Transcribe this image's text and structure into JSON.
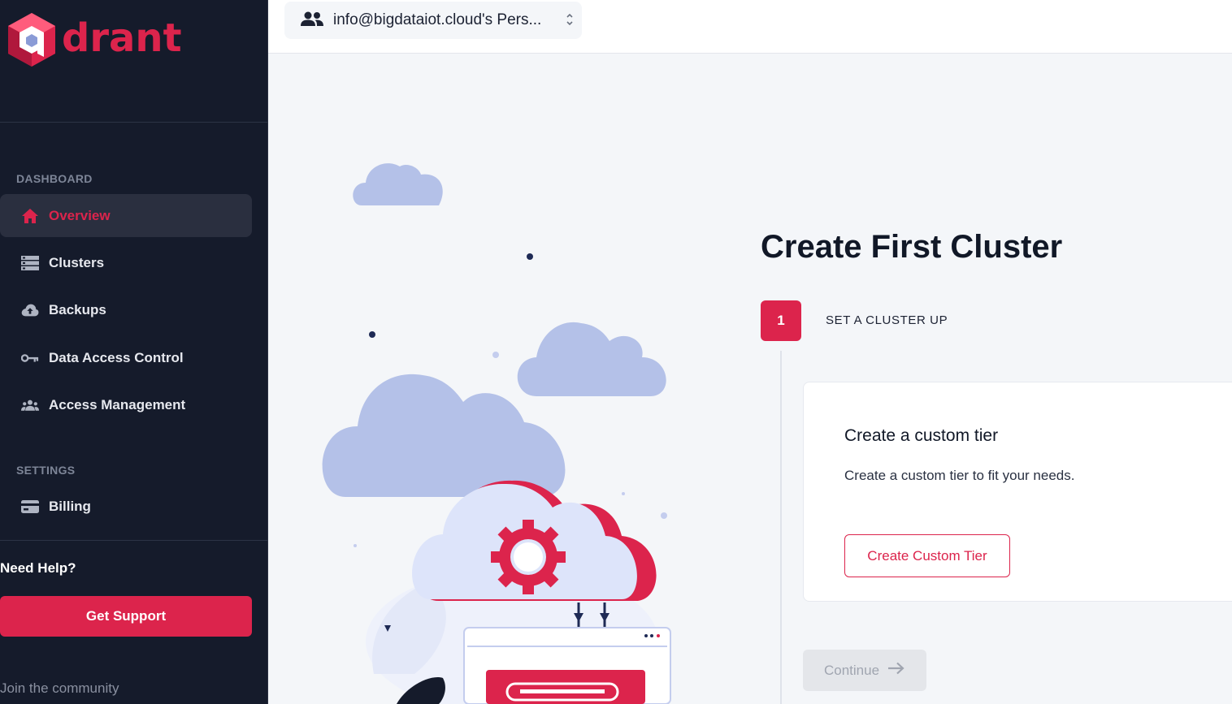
{
  "brand": {
    "logo_text": "drant",
    "accent": "#dc244c"
  },
  "topbar": {
    "account_label": "info@bigdataiot.cloud's Pers..."
  },
  "sidebar": {
    "section_dashboard": "DASHBOARD",
    "items": [
      {
        "label": "Overview",
        "icon": "home-icon",
        "active": true
      },
      {
        "label": "Clusters",
        "icon": "server-icon"
      },
      {
        "label": "Backups",
        "icon": "cloud-upload-icon"
      },
      {
        "label": "Data Access Control",
        "icon": "key-icon"
      },
      {
        "label": "Access Management",
        "icon": "people-icon"
      }
    ],
    "section_settings": "SETTINGS",
    "settings_items": [
      {
        "label": "Billing",
        "icon": "credit-card-icon"
      }
    ],
    "help_title": "Need Help?",
    "support_button": "Get Support",
    "community_link": "Join the community"
  },
  "main": {
    "title": "Create First Cluster",
    "step_number": "1",
    "step_label": "SET A CLUSTER UP",
    "card": {
      "title": "Create a custom tier",
      "description": "Create a custom tier to fit your needs.",
      "button": "Create Custom Tier"
    },
    "continue_button": "Continue"
  }
}
